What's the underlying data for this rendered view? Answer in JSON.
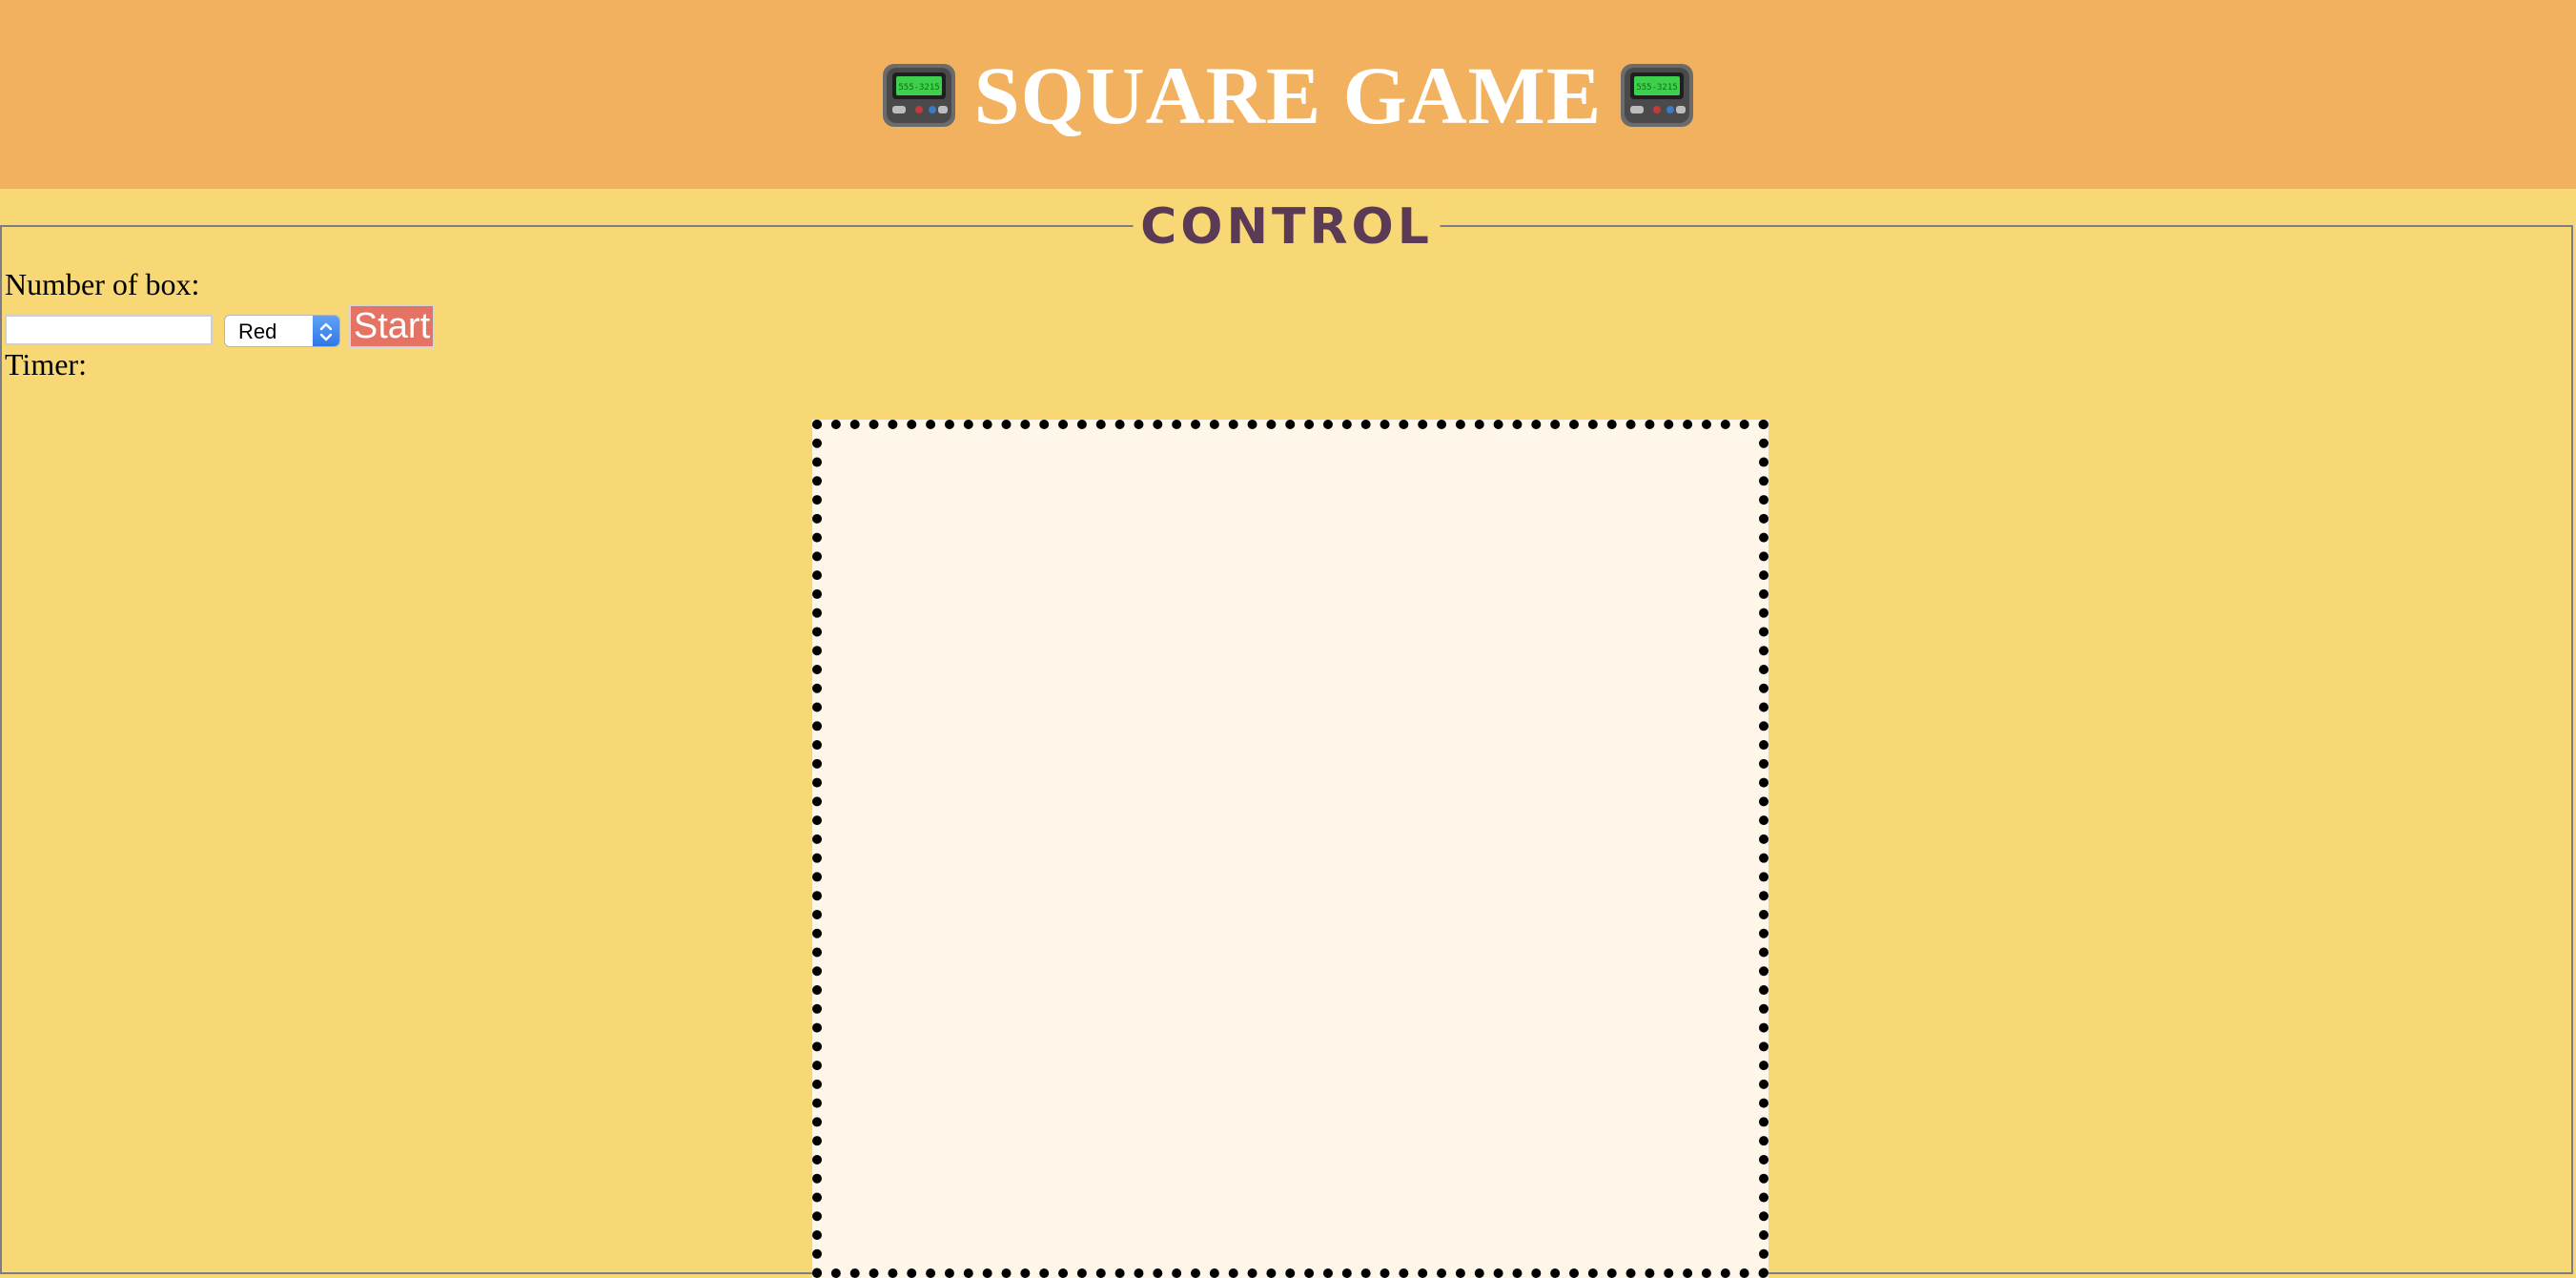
{
  "header": {
    "title": "SQUARE GAME",
    "icon": "pager-icon",
    "pager_display": "555-3215",
    "background": "#f2b15e"
  },
  "control": {
    "legend": "CONTROL",
    "number_label": "Number of box:",
    "number_value": "",
    "color_selected": "Red",
    "start_label": "Start",
    "timer_label": "Timer:",
    "start_color": "#e57363"
  },
  "board": {
    "background": "#fef7e9"
  },
  "page": {
    "background": "#f8d775"
  }
}
